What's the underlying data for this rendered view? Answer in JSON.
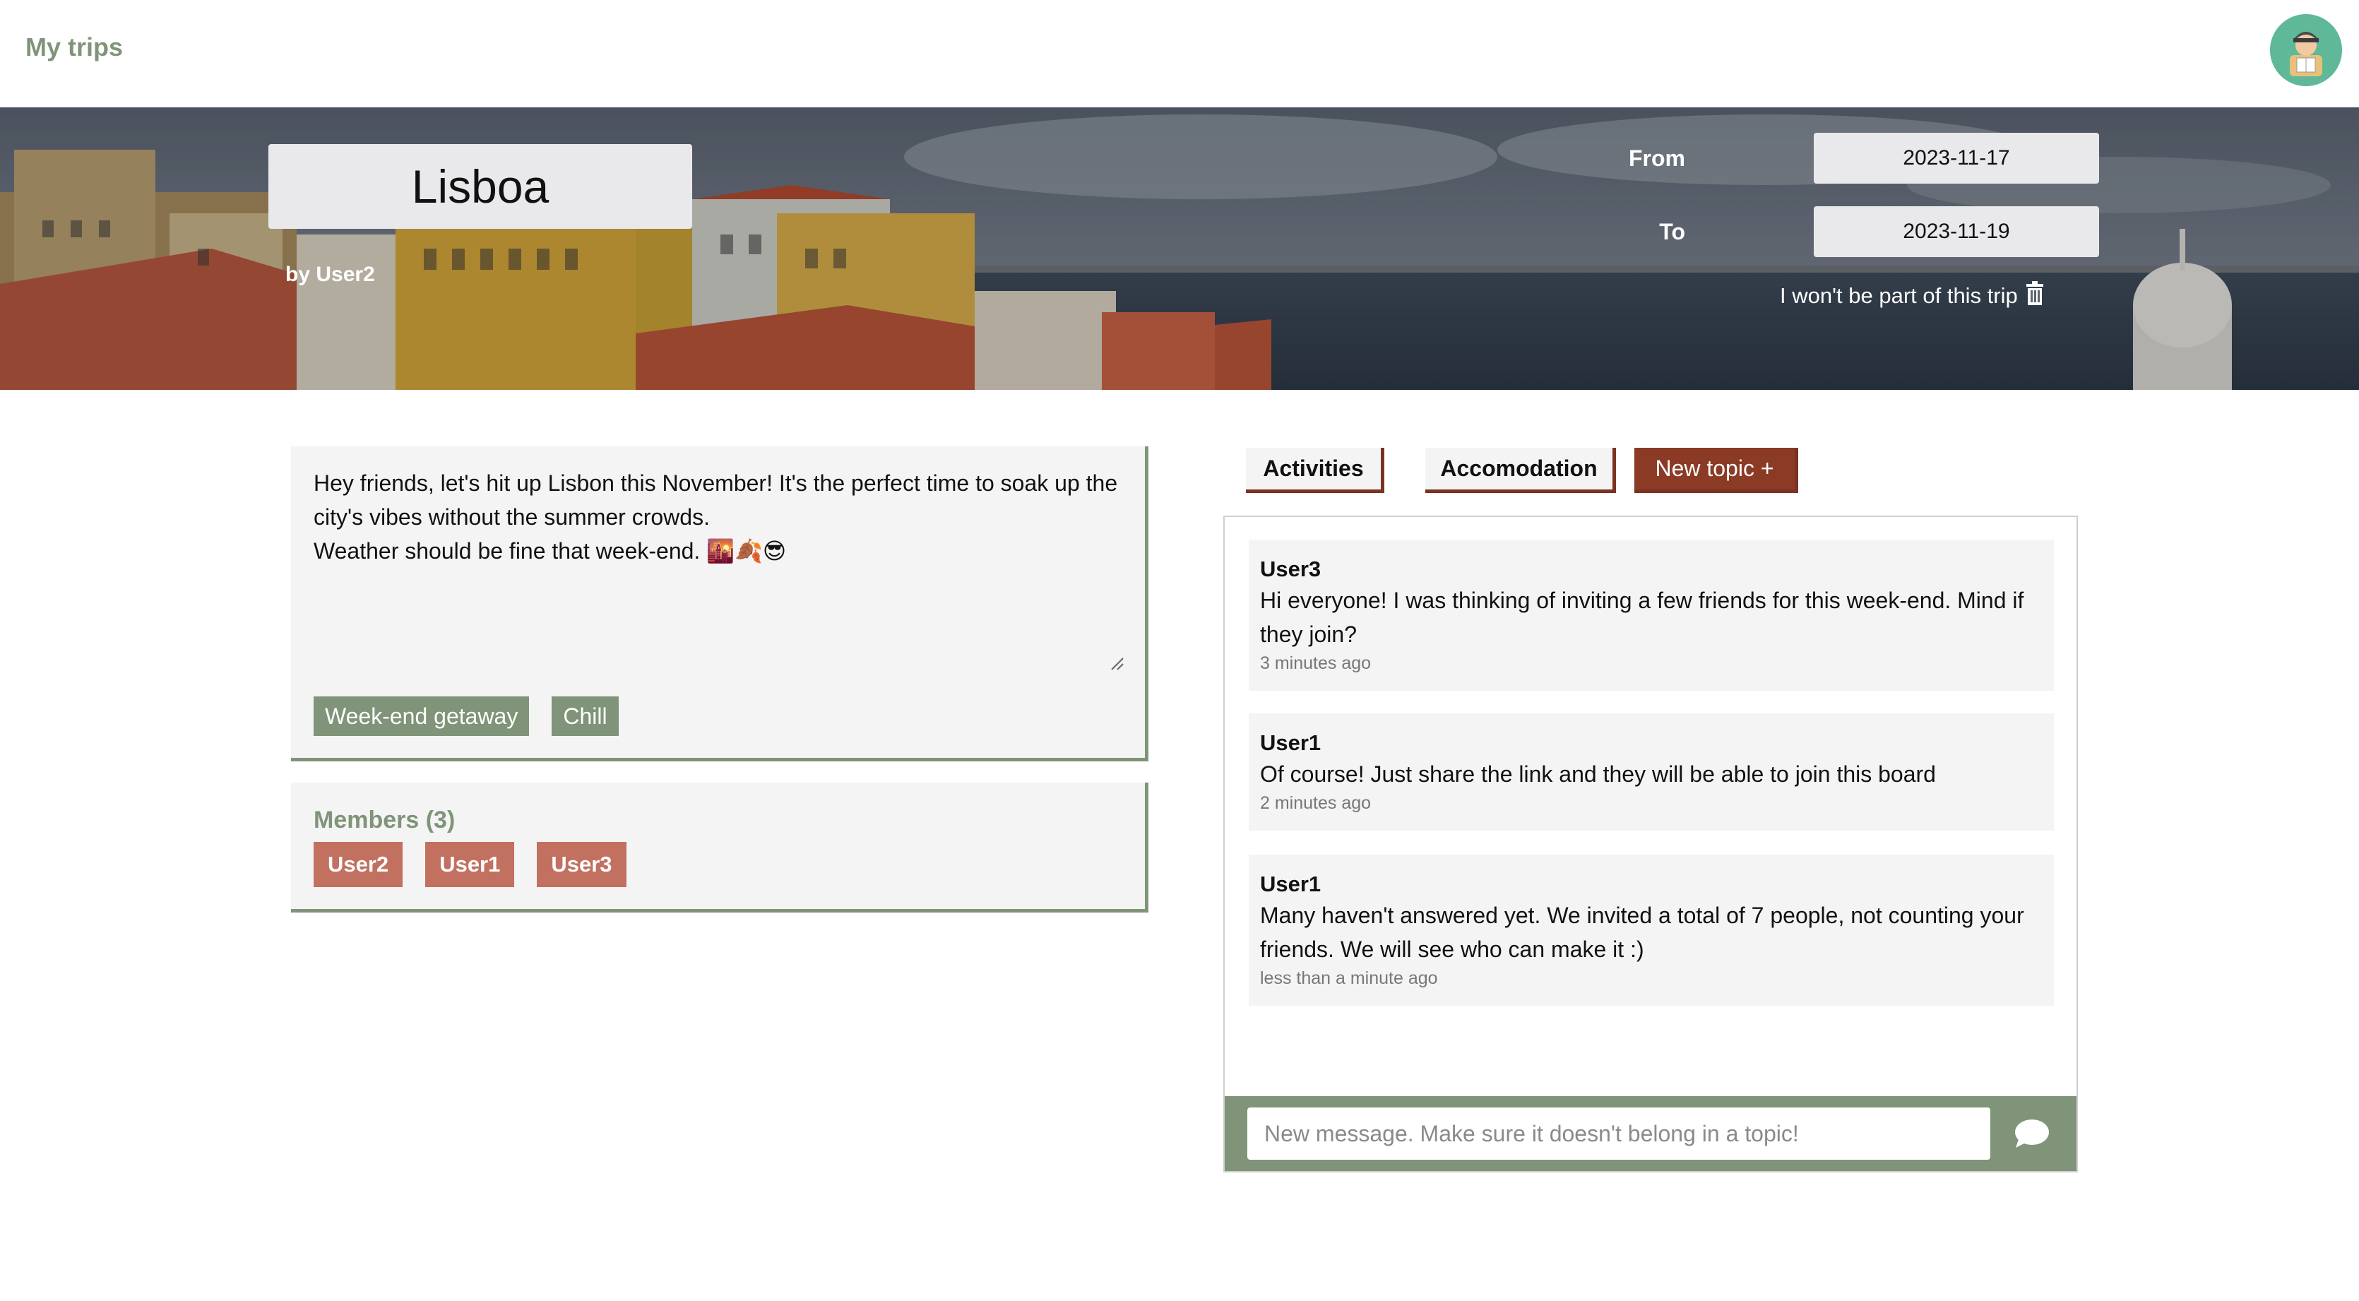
{
  "nav": {
    "brand": "My trips",
    "avatar_icon": "traveler-avatar-icon"
  },
  "trip": {
    "title": "Lisboa",
    "author": "by User2",
    "from_label": "From",
    "from_value": "2023-11-17",
    "to_label": "To",
    "to_value": "2023-11-19",
    "leave_label": "I won't be part of this trip",
    "leave_icon": "trash-icon",
    "description": "Hey friends, let's hit up Lisbon this November! It's the perfect time to soak up the city's vibes without the summer crowds.\nWeather should be fine that week-end. 🌇🍂😎",
    "tags": [
      "Week-end getaway",
      "Chill"
    ]
  },
  "members": {
    "title": "Members (3)",
    "list": [
      "User2",
      "User1",
      "User3"
    ]
  },
  "topics": {
    "tabs": [
      "Activities",
      "Accomodation"
    ],
    "new_topic_label": "New topic +"
  },
  "chat": {
    "messages": [
      {
        "author": "User3",
        "text": "Hi everyone! I was thinking of inviting a few friends for this week-end. Mind if they join?",
        "time": "3 minutes ago"
      },
      {
        "author": "User1",
        "text": "Of course! Just share the link and they will be able to join this board",
        "time": "2 minutes ago"
      },
      {
        "author": "User1",
        "text": "Many haven't answered yet. We invited a total of 7 people, not counting your friends. We will see who can make it :)",
        "time": "less than a minute ago"
      }
    ],
    "input_placeholder": "New message. Make sure it doesn't belong in a topic!",
    "send_icon": "speech-bubble-icon"
  },
  "colors": {
    "accent_green": "#7f9479",
    "member_red": "#c27060",
    "topic_brown": "#8b3a26",
    "panel_bg": "#f4f4f4"
  }
}
